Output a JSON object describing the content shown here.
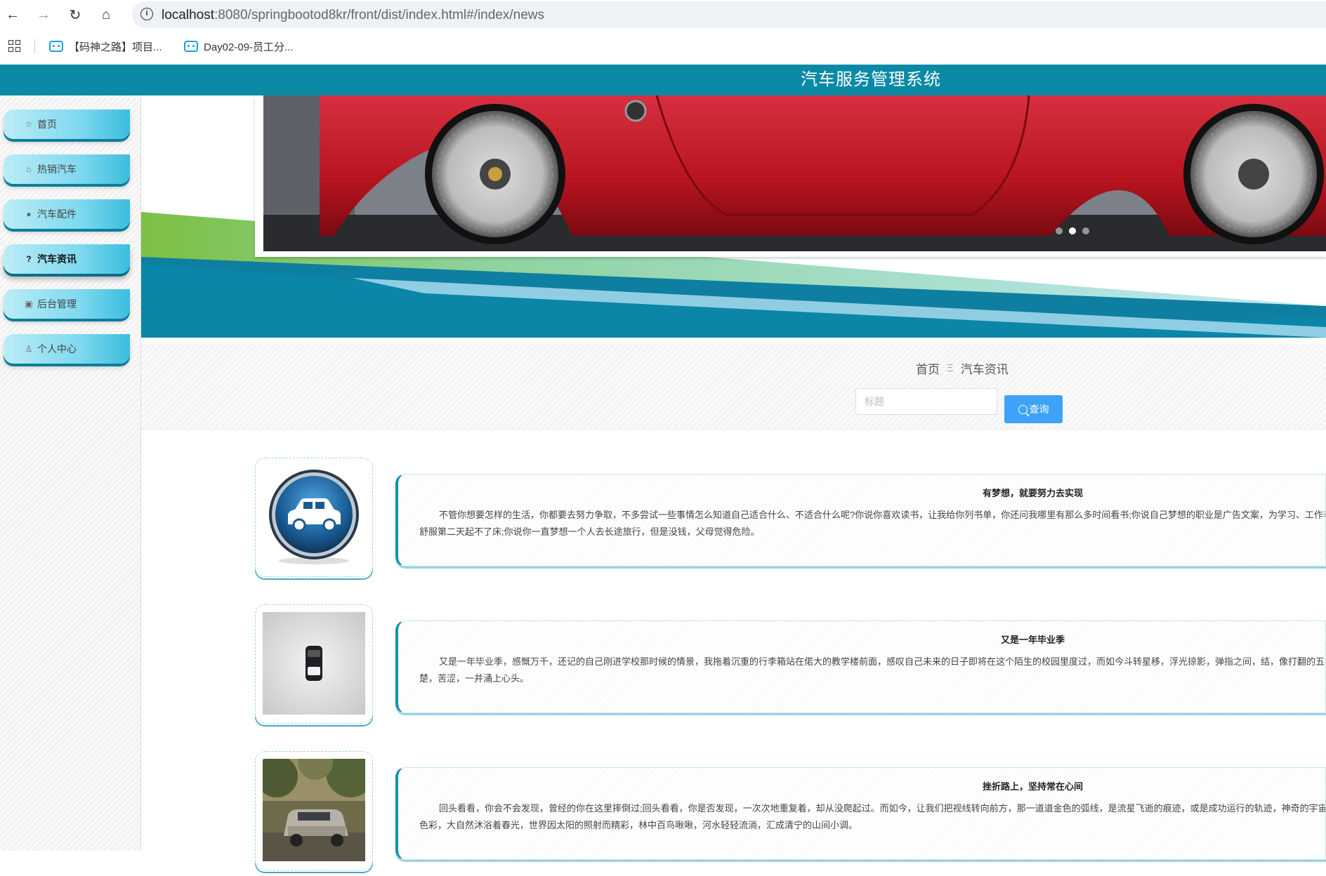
{
  "browser": {
    "url_host": "localhost",
    "url_rest": ":8080/springbootod8kr/front/dist/index.html#/index/news",
    "bookmarks": [
      {
        "label": "【码神之路】项目..."
      },
      {
        "label": "Day02-09-员工分..."
      }
    ]
  },
  "site": {
    "title": "汽车服务管理系统"
  },
  "sidebar": {
    "items": [
      {
        "label": "首页",
        "icon": "star-icon",
        "glyph": "☆"
      },
      {
        "label": "热销汽车",
        "icon": "bag-icon",
        "glyph": "⌂"
      },
      {
        "label": "汽车配件",
        "icon": "alert-icon",
        "glyph": "●"
      },
      {
        "label": "汽车资讯",
        "icon": "question-icon",
        "glyph": "?"
      },
      {
        "label": "后台管理",
        "icon": "briefcase-icon",
        "glyph": "▣"
      },
      {
        "label": "个人中心",
        "icon": "user-icon",
        "glyph": "♙"
      }
    ],
    "active_index": 3
  },
  "carousel": {
    "slide_count": 3,
    "active_slide": 1
  },
  "breadcrumb": {
    "home": "首页",
    "separator": "Ξ",
    "current": "汽车资讯"
  },
  "search": {
    "placeholder": "标题",
    "value": "",
    "button_label": "查询"
  },
  "news": [
    {
      "title": "有梦想，就要努力去实现",
      "body": "不管你想要怎样的生活，你都要去努力争取，不多尝试一些事情怎么知道自己适合什么、不适合什么呢?你说你喜欢读书，让我给你列书单，你还问我哪里有那么多时间看书;你说自己梦想的职业是广告文案，为学习、工作辛苦或者身体不舒服第二天起不了床;你说你一直梦想一个人去长途旅行，但是没钱，父母觉得危险。",
      "thumb": "car-icon"
    },
    {
      "title": "又是一年毕业季",
      "body": "又是一年毕业季，感慨万千，还记的自己刚进学校那时候的情景，我拖着沉重的行李箱站在偌大的教学楼前面，感叹自己未来的日子即将在这个陌生的校园里度过，而如今斗转星移，浮光掠影，弹指之间，结，像打翻的五味瓶，甜蜜，酸楚，苦涩，一并涌上心头。",
      "thumb": "car-top-view"
    },
    {
      "title": "挫折路上，坚持常在心间",
      "body": "回头看看，你会不会发现，曾经的你在这里摔倒过;回头看看，你是否发现，一次次地重复着，却从没爬起过。而如今，让我们把视线转向前方，那一道道金色的弧线，是流星飞逝的痕迹，或是成功运行的轨迹，神奇的宇宙赋予它神奇的色彩，大自然沐浴着春光，世界因太阳的照射而精彩，林中百鸟啾啾，河水轻轻流淌，汇成清宁的山间小调。",
      "thumb": "suv-photo"
    }
  ],
  "colors": {
    "header": "#0b8aa6",
    "accent": "#3ea3f8",
    "sidebar_item": "#7fd9ef"
  }
}
